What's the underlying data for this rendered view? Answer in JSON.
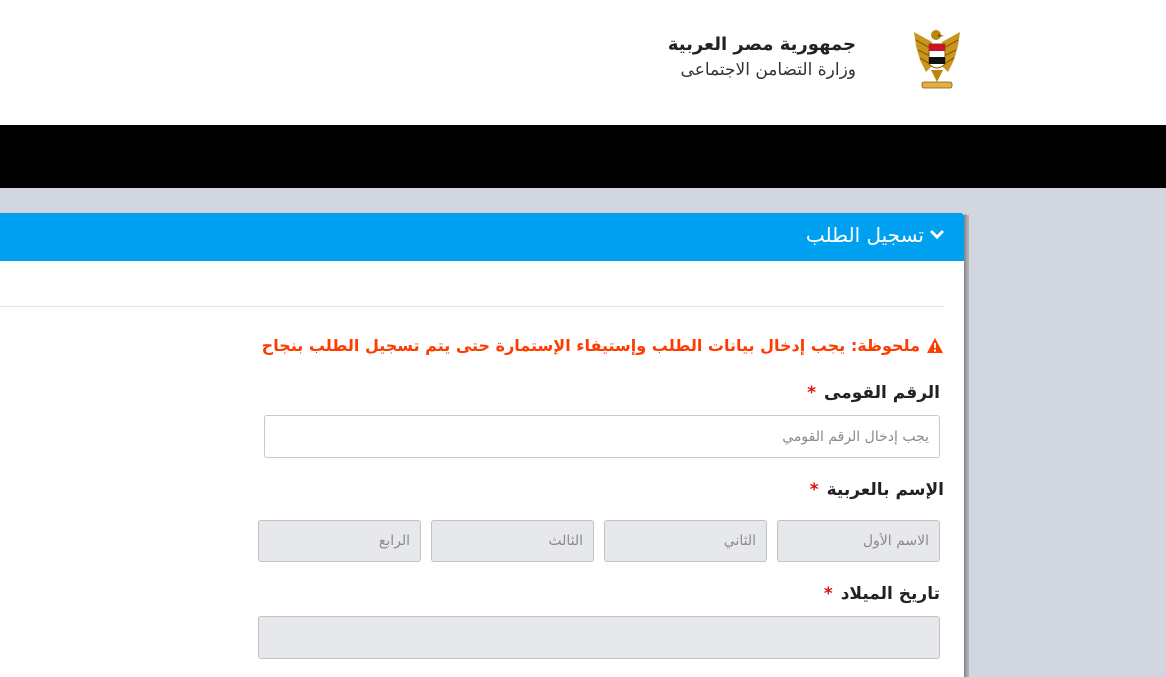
{
  "header": {
    "country": "جمهورية مصر العربية",
    "ministry": "وزارة التضامن الاجتماعى",
    "logo_icon": "egypt-eagle-emblem-icon"
  },
  "panel": {
    "title": "تسجيل الطلب",
    "note": "ملحوظة: يجب إدخال بيانات الطلب وإستيفاء الإستمارة حتى يتم تسجيل الطلب بنجاح"
  },
  "form": {
    "required_mark": "*",
    "national_id": {
      "label": "الرقم القومى",
      "placeholder": "يجب إدخال الرقم القومي"
    },
    "arabic_name": {
      "label": "الإسم بالعربية",
      "first_placeholder": "الاسم الأول",
      "second_placeholder": "الثاني",
      "third_placeholder": "الثالث",
      "fourth_placeholder": "الرابع"
    },
    "birth_date": {
      "label": "تاريخ الميلاد"
    }
  },
  "colors": {
    "panel_header": "#00a0f0",
    "navbar": "#000000",
    "note_text": "#ff3b00",
    "required_star": "#dd1111"
  }
}
